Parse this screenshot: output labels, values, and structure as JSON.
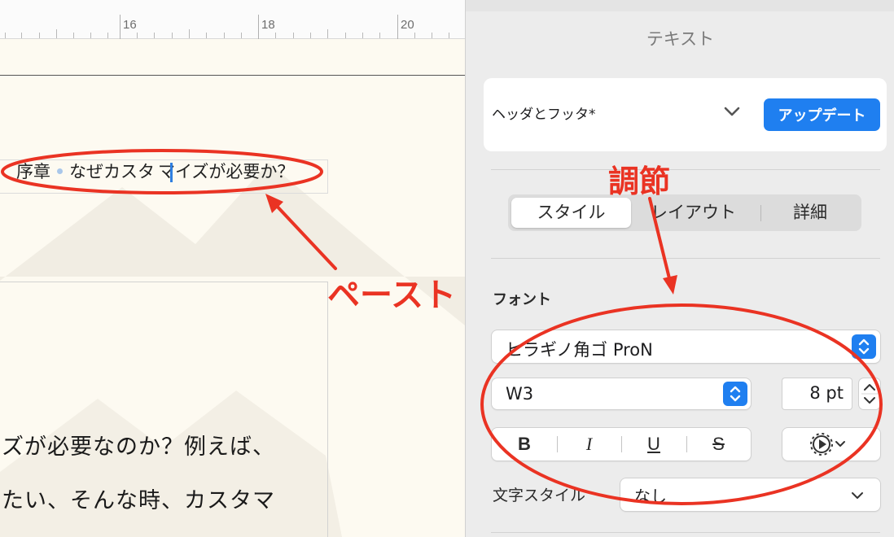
{
  "ruler": {
    "labels": [
      "16",
      "18",
      "20"
    ]
  },
  "document": {
    "header_text_before_caret": "序章",
    "header_text_mid": "なぜカスタ",
    "header_text_after_caret": "マイズが必要か？",
    "body_lines": [
      "ズが必要なのか？例えば、",
      "たい、そんな時、カスタマ"
    ]
  },
  "inspector": {
    "title": "テキスト",
    "paragraph_style": {
      "label": "ヘッダとフッタ*",
      "update_label": "アップデート"
    },
    "tabs": [
      {
        "label": "スタイル",
        "selected": true
      },
      {
        "label": "レイアウト",
        "selected": false
      },
      {
        "label": "詳細",
        "selected": false
      }
    ],
    "font_section": {
      "label": "フォント",
      "family": "ヒラギノ角ゴ ProN",
      "weight": "W3",
      "size": "8 pt",
      "style_buttons": [
        {
          "label": "B",
          "icon": "bold-icon"
        },
        {
          "label": "I",
          "icon": "italic-icon"
        },
        {
          "label": "U",
          "icon": "underline-icon"
        },
        {
          "label": "S",
          "icon": "strikethrough-icon"
        }
      ],
      "options_icon": "gear-icon"
    },
    "character_style": {
      "label": "文字スタイル",
      "value": "なし"
    }
  },
  "annotations": {
    "paste_label": "ペースト",
    "adjust_label": "調節",
    "color": "#ea3323"
  },
  "colors": {
    "accent": "#1f7ff0",
    "page_background": "#fdfaf1",
    "inspector_background": "#ececec"
  }
}
